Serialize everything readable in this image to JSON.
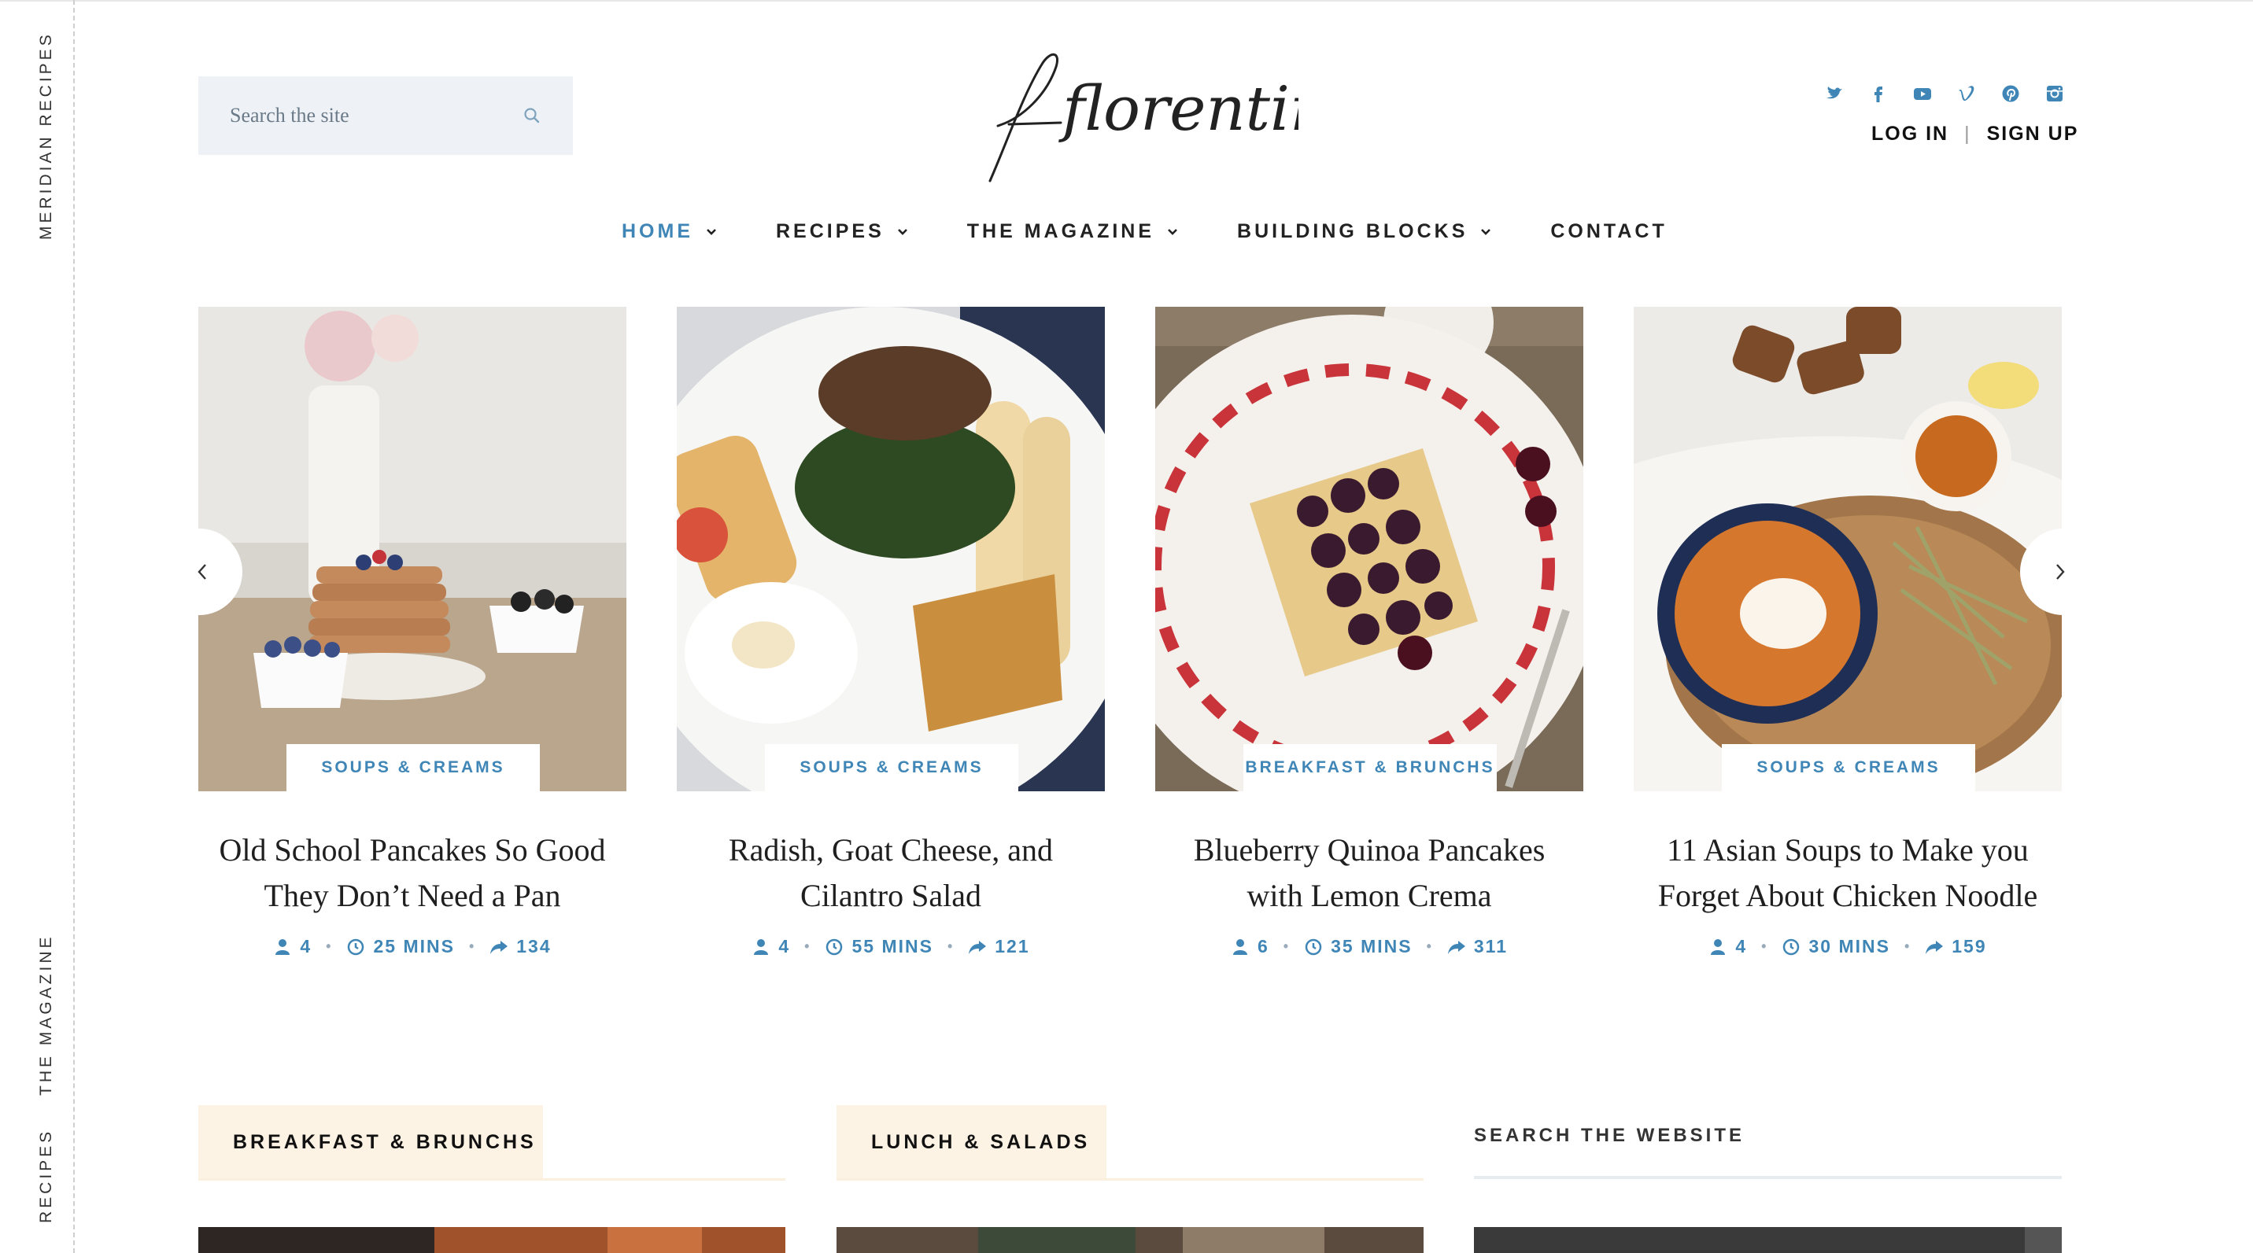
{
  "rail": {
    "top_label": "MERIDIAN RECIPES",
    "magazine_label": "THE MAGAZINE",
    "recipes_label": "RECIPES"
  },
  "header": {
    "search_placeholder": "Search the site",
    "logo_text": "florentine",
    "social_icons": [
      "twitter-icon",
      "facebook-icon",
      "youtube-icon",
      "vimeo-icon",
      "pinterest-icon",
      "instagram-icon"
    ],
    "login_label": "LOG IN",
    "separator": "|",
    "signup_label": "SIGN UP"
  },
  "nav": {
    "items": [
      {
        "label": "HOME",
        "active": true
      },
      {
        "label": "RECIPES",
        "active": false
      },
      {
        "label": "THE MAGAZINE",
        "active": false
      },
      {
        "label": "BUILDING BLOCKS",
        "active": false
      },
      {
        "label": "CONTACT",
        "active": false
      }
    ]
  },
  "carousel": {
    "cards": [
      {
        "category": "SOUPS & CREAMS",
        "title": "Old School Pancakes So Good They Don’t Need a Pan",
        "servings": "4",
        "time": "25 MINS",
        "shares": "134"
      },
      {
        "category": "SOUPS & CREAMS",
        "title": "Radish, Goat Cheese, and Cilantro Salad",
        "servings": "4",
        "time": "55 MINS",
        "shares": "121"
      },
      {
        "category": "BREAKFAST & BRUNCHS",
        "title": "Blueberry Quinoa Pancakes with Lemon Crema",
        "servings": "6",
        "time": "35 MINS",
        "shares": "311"
      },
      {
        "category": "SOUPS & CREAMS",
        "title": "11 Asian Soups to Make you Forget About Chicken Noodle",
        "servings": "4",
        "time": "30 MINS",
        "shares": "159"
      }
    ]
  },
  "sections": {
    "breakfast_label": "BREAKFAST & BRUNCHS",
    "lunch_label": "LUNCH & SALADS",
    "search_label": "SEARCH THE WEBSITE"
  },
  "colors": {
    "accent": "#3f86b7",
    "tab_bg": "#fdf3e4",
    "search_bg": "#eef2f6"
  }
}
